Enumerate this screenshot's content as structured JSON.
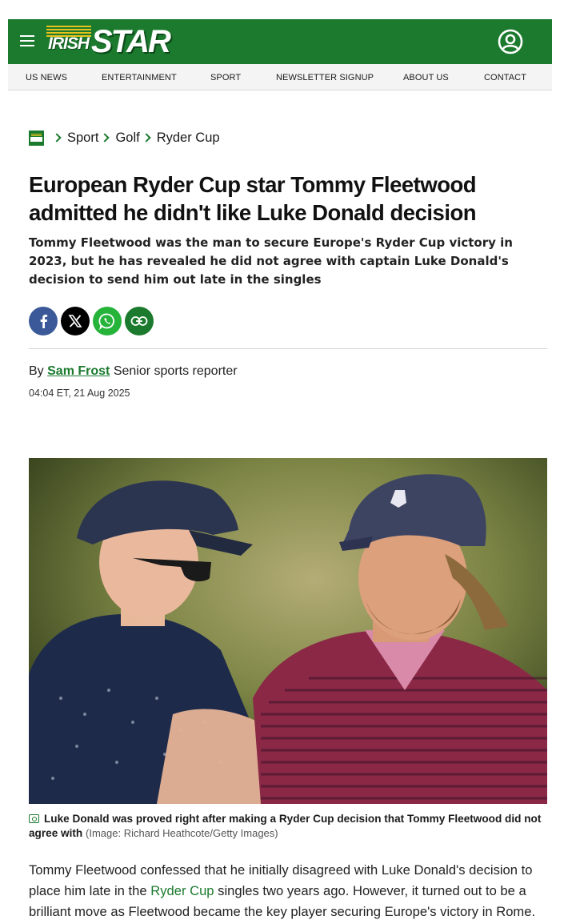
{
  "header": {
    "logo_irish": "IRISH",
    "logo_star": "STAR"
  },
  "nav": {
    "items": [
      {
        "label": "US NEWS"
      },
      {
        "label": "ENTERTAINMENT"
      },
      {
        "label": "SPORT"
      },
      {
        "label": "NEWSLETTER SIGNUP"
      },
      {
        "label": "ABOUT US"
      },
      {
        "label": "CONTACT"
      }
    ]
  },
  "breadcrumb": {
    "items": [
      "Sport",
      "Golf",
      "Ryder Cup"
    ]
  },
  "article": {
    "headline": "European Ryder Cup star Tommy Fleetwood admitted he didn't like Luke Donald decision",
    "standfirst": "Tommy Fleetwood was the man to secure Europe's Ryder Cup victory in 2023, but he has revealed he did not agree with captain Luke Donald's decision to send him out late in the singles",
    "byline_prefix": "By",
    "author": "Sam Frost",
    "author_role": "Senior sports reporter",
    "date": "04:04 ET, 21 Aug 2025",
    "photo_caption": "Luke Donald was proved right after making a Ryder Cup decision that Tommy Fleetwood did not agree with",
    "photo_credit": "(Image: Richard Heathcote/Getty Images)",
    "body_part1": "Tommy Fleetwood confessed that he initially disagreed with Luke Donald's decision to place him late in the",
    "body_link": "Ryder Cup",
    "body_part2": "singles two years ago. However, it turned out to be a brilliant move as Fleetwood became the key player securing Europe's victory in Rome."
  },
  "colors": {
    "brand_green": "#1b7a2e",
    "facebook": "#3b5998",
    "whatsapp": "#25b33a"
  },
  "icons": [
    "menu-icon",
    "account-icon",
    "facebook-icon",
    "x-icon",
    "whatsapp-icon",
    "link-icon",
    "camera-icon"
  ]
}
